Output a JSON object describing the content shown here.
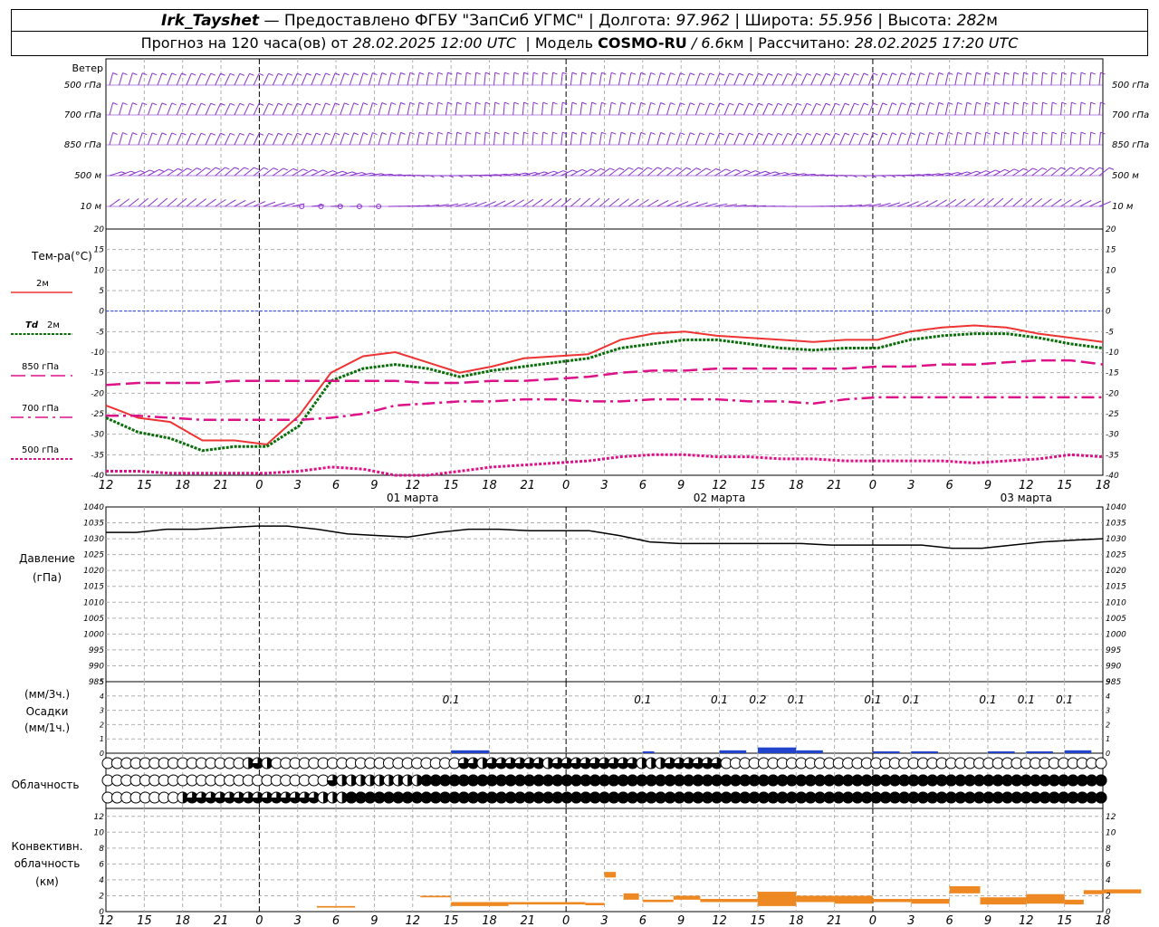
{
  "header": {
    "station": "Irk_Tayshet",
    "provider": "— Предоставлено ФГБУ \"ЗапСиб УГМС\"",
    "lon_label": "Долгота:",
    "lon_value": "97.962",
    "lat_label": "Широта:",
    "lat_value": "55.956",
    "alt_label": "Высота:",
    "alt_value": "282",
    "alt_unit": "м",
    "forecast_label": "Прогноз на 120 часа(ов) от",
    "forecast_time": "28.02.2025 12:00 UTC",
    "model_label": "Модель",
    "model_name": "COSMO-RU",
    "model_res": "/ 6.6",
    "model_res_unit": "км",
    "calc_label": "Рассчитано:",
    "calc_time": "28.02.2025 17:20 UTC"
  },
  "labels": {
    "wind": "Ветер",
    "wind_levels": [
      "500 гПа",
      "700 гПа",
      "850 гПа",
      "500 м",
      "10 м"
    ],
    "temp_title": "Тем-ра(°C)",
    "temp_2m": "2м",
    "td_2m_a": "Td",
    "td_2m_b": "2м",
    "temp_850": "850 гПа",
    "temp_700": "700 гПа",
    "temp_500": "500 гПа",
    "pressure_a": "Давление",
    "pressure_b": "(гПа)",
    "precip_a": "(мм/3ч.)",
    "precip_b": "Осадки",
    "precip_c": "(мм/1ч.)",
    "cloud": "Облачность",
    "conv_a": "Конвективн.",
    "conv_b": "облачность",
    "conv_c": "(км)"
  },
  "chart_data": {
    "type": "line",
    "x_ticks": [
      "12",
      "15",
      "18",
      "21",
      "0",
      "3",
      "6",
      "9",
      "12",
      "15",
      "18",
      "21",
      "0",
      "3",
      "6",
      "9",
      "12",
      "15",
      "18",
      "21",
      "0",
      "3",
      "6",
      "9",
      "12",
      "15",
      "18"
    ],
    "date_labels": [
      "01 марта",
      "02 марта",
      "03 марта"
    ],
    "date_label_ticks": [
      8,
      16,
      24
    ],
    "colors": {
      "t2m": "#ee3333",
      "td2m": "#0a6e0a",
      "t850": "#dd1188",
      "t700": "#dd1188",
      "t500": "#dd1188",
      "pressure": "#000000",
      "precip": "#2244cc",
      "conv": "#ee8822",
      "wind": "#8833cc",
      "zero": "#2244ee"
    },
    "temperature": {
      "ylim": [
        -40,
        20
      ],
      "yticks": [
        20,
        15,
        10,
        5,
        0,
        -5,
        -10,
        -15,
        -20,
        -25,
        -30,
        -35,
        -40
      ],
      "series": [
        {
          "key": "t2m",
          "name": "2м",
          "values": [
            -23,
            -26,
            -27,
            -31.5,
            -31.5,
            -32.5,
            -25.5,
            -15,
            -11,
            -10,
            -12.5,
            -15,
            -13.5,
            -11.5,
            -11,
            -10.5,
            -7,
            -5.5,
            -5,
            -6,
            -6.5,
            -7,
            -7.5,
            -7,
            -7,
            -5,
            -4,
            -3.5,
            -4,
            -5.5,
            -6.5,
            -7.5
          ]
        },
        {
          "key": "td2m",
          "name": "Td 2м",
          "values": [
            -26,
            -29.5,
            -31,
            -34,
            -33,
            -33,
            -28,
            -17,
            -14,
            -13,
            -14,
            -16,
            -14.5,
            -13.5,
            -12.5,
            -11.5,
            -9,
            -8,
            -7,
            -7,
            -8,
            -9,
            -9.5,
            -9,
            -9,
            -7,
            -6,
            -5.5,
            -5.5,
            -6.5,
            -8,
            -9
          ]
        },
        {
          "key": "t850",
          "name": "850 гПа",
          "values": [
            -18,
            -17.5,
            -17.5,
            -17.5,
            -17,
            -17,
            -17,
            -17,
            -17,
            -17,
            -17.5,
            -17.5,
            -17,
            -17,
            -16.5,
            -16,
            -15,
            -14.5,
            -14.5,
            -14,
            -14,
            -14,
            -14,
            -14,
            -13.5,
            -13.5,
            -13,
            -13,
            -12.5,
            -12,
            -12,
            -13
          ]
        },
        {
          "key": "t700",
          "name": "700 гПа",
          "values": [
            -25.5,
            -25.5,
            -26,
            -26.5,
            -26.5,
            -26.5,
            -26.5,
            -26,
            -25,
            -23,
            -22.5,
            -22,
            -22,
            -21.5,
            -21.5,
            -22,
            -22,
            -21.5,
            -21.5,
            -21.5,
            -22,
            -22,
            -22.5,
            -21.5,
            -21,
            -21,
            -21,
            -21,
            -21,
            -21,
            -21,
            -21
          ]
        },
        {
          "key": "t500",
          "name": "500 гПа",
          "values": [
            -39,
            -39,
            -39.5,
            -39.5,
            -39.5,
            -39.5,
            -39,
            -38,
            -38.5,
            -40,
            -40,
            -39,
            -38,
            -37.5,
            -37,
            -36.5,
            -35.5,
            -35,
            -35,
            -35.5,
            -35.5,
            -36,
            -36,
            -36.5,
            -36.5,
            -36.5,
            -36.5,
            -37,
            -36.5,
            -36,
            -35,
            -35.5
          ]
        }
      ]
    },
    "pressure": {
      "ylim": [
        985,
        1040
      ],
      "yticks": [
        1040,
        1035,
        1030,
        1025,
        1020,
        1015,
        1010,
        1005,
        1000,
        995,
        990,
        985
      ],
      "values": [
        1032,
        1032,
        1033,
        1033,
        1033.5,
        1034,
        1034,
        1033,
        1031.5,
        1031,
        1030.5,
        1032,
        1033,
        1033,
        1032.5,
        1032.5,
        1032.5,
        1031,
        1029,
        1028.5,
        1028.5,
        1028.5,
        1028.5,
        1028.5,
        1028,
        1028,
        1028,
        1028,
        1027,
        1027,
        1028,
        1029,
        1029.5,
        1030
      ]
    },
    "precipitation": {
      "ylim": [
        0,
        5
      ],
      "yticks": [
        5,
        4,
        3,
        2,
        1,
        0
      ],
      "labels": [
        "0.1",
        "0.1",
        "0.1",
        "0.2",
        "0.1",
        "0.1",
        "0.1",
        "0.1",
        "0.1",
        "0.1"
      ],
      "label_ticks": [
        9,
        14,
        16,
        17,
        18,
        20,
        21,
        23,
        24,
        25
      ],
      "bars": [
        {
          "start": 9.0,
          "end": 10.0,
          "value": 0.1
        },
        {
          "start": 14.0,
          "end": 14.3,
          "value": 0.05
        },
        {
          "start": 16.0,
          "end": 16.7,
          "value": 0.1
        },
        {
          "start": 17.0,
          "end": 18.0,
          "value": 0.2
        },
        {
          "start": 18.0,
          "end": 18.7,
          "value": 0.1
        },
        {
          "start": 20.0,
          "end": 20.7,
          "value": 0.05
        },
        {
          "start": 21.0,
          "end": 21.7,
          "value": 0.05
        },
        {
          "start": 23.0,
          "end": 23.7,
          "value": 0.05
        },
        {
          "start": 24.0,
          "end": 24.7,
          "value": 0.05
        },
        {
          "start": 25.0,
          "end": 25.7,
          "value": 0.1
        }
      ]
    },
    "cloud_cover": {
      "rows_note": "oktas 0-8 per step, three levels",
      "upper": [
        0,
        0,
        0,
        0,
        0,
        0,
        0,
        0,
        0,
        0,
        0,
        0,
        0,
        0,
        0,
        0,
        0,
        0,
        0,
        0,
        0,
        0,
        0,
        0,
        0,
        0,
        0,
        0,
        0,
        0,
        0,
        0,
        0,
        0,
        0,
        0,
        0,
        0,
        0,
        0,
        0,
        0,
        0,
        0,
        0,
        0,
        0,
        0,
        0,
        0,
        0,
        0,
        0,
        0,
        0,
        0,
        0,
        0,
        0,
        0,
        0,
        0,
        0,
        0,
        0,
        0,
        0,
        0,
        0,
        0,
        0,
        0,
        0,
        0,
        0,
        0,
        0,
        0,
        0,
        0,
        0,
        0,
        0,
        0,
        0,
        0,
        0,
        0,
        0,
        0,
        0,
        0,
        0,
        0,
        0,
        0,
        0,
        0,
        0,
        0,
        0
      ],
      "upper_sparse": {
        "15": 4,
        "16": 6,
        "17": 4,
        "38": 6,
        "39": 6,
        "40": 4,
        "41": 6,
        "42": 6,
        "43": 6,
        "44": 6,
        "45": 6,
        "46": 6,
        "47": 4,
        "48": 6,
        "49": 6,
        "50": 6,
        "51": 6,
        "52": 6,
        "53": 6,
        "54": 6,
        "55": 6,
        "56": 6,
        "57": 4,
        "58": 4,
        "59": 4,
        "60": 6,
        "61": 6,
        "62": 6,
        "63": 6,
        "64": 6,
        "65": 6
      },
      "middle_sparse": {
        "24": 6,
        "25": 4,
        "26": 4,
        "27": 4,
        "28": 4,
        "29": 4,
        "30": 4,
        "31": 4,
        "32": 4,
        "33": 4,
        "34": 8,
        "35": 8,
        "36": 8,
        "37": 8,
        "38": 8,
        "39": 8,
        "40": 8,
        "41": 8,
        "42": 8,
        "43": 8,
        "44": 8,
        "45": 8,
        "46": 8,
        "47": 8,
        "48": 8,
        "49": 8,
        "50": 8,
        "51": 8,
        "52": 8,
        "53": 8,
        "54": 8,
        "55": 8,
        "56": 8,
        "57": 8,
        "58": 8,
        "59": 8,
        "60": 8,
        "61": 8,
        "62": 8,
        "63": 8,
        "64": 8,
        "65": 8,
        "66": 8,
        "67": 8,
        "68": 8,
        "69": 8,
        "70": 8,
        "71": 8,
        "72": 8,
        "73": 8,
        "74": 8,
        "75": 8,
        "76": 8,
        "77": 8,
        "78": 8,
        "79": 8,
        "80": 8,
        "81": 8,
        "82": 8,
        "83": 8,
        "84": 8,
        "85": 8,
        "86": 8,
        "87": 8,
        "88": 8,
        "89": 8,
        "90": 8,
        "91": 8,
        "92": 8,
        "93": 8,
        "94": 8,
        "95": 8,
        "96": 8,
        "97": 8,
        "98": 8,
        "99": 8,
        "100": 8,
        "101": 8,
        "102": 8,
        "103": 8,
        "104": 8,
        "105": 8,
        "106": 8
      },
      "lower_sparse": {
        "8": 4,
        "9": 6,
        "10": 6,
        "11": 6,
        "12": 6,
        "13": 6,
        "14": 6,
        "15": 6,
        "16": 6,
        "17": 6,
        "18": 6,
        "19": 6,
        "20": 6,
        "21": 6,
        "22": 6,
        "23": 4,
        "24": 4,
        "25": 4,
        "26": 8,
        "27": 8,
        "28": 8,
        "29": 8,
        "30": 8,
        "31": 8,
        "32": 8,
        "33": 8,
        "34": 8,
        "35": 8,
        "36": 8,
        "37": 8,
        "38": 8,
        "39": 8,
        "40": 8,
        "41": 8,
        "42": 8,
        "43": 8,
        "44": 8,
        "45": 8,
        "46": 8,
        "47": 8,
        "48": 8,
        "49": 8,
        "50": 8,
        "51": 8,
        "52": 8,
        "53": 8,
        "54": 8,
        "55": 8,
        "56": 8,
        "57": 8,
        "58": 8,
        "59": 8,
        "60": 8,
        "61": 8,
        "62": 8,
        "63": 8,
        "64": 8,
        "65": 8,
        "66": 8,
        "67": 8,
        "68": 8,
        "69": 8,
        "70": 8,
        "71": 8,
        "72": 8,
        "73": 8,
        "74": 8,
        "75": 8,
        "76": 8,
        "77": 8,
        "78": 8,
        "79": 8,
        "80": 8,
        "81": 8,
        "82": 8,
        "83": 8,
        "84": 8,
        "85": 8,
        "86": 8,
        "87": 8,
        "88": 8,
        "89": 8,
        "90": 8,
        "91": 8,
        "92": 8,
        "93": 8,
        "94": 8,
        "95": 8,
        "96": 8,
        "97": 8,
        "98": 8,
        "99": 8,
        "100": 8,
        "101": 8,
        "102": 8,
        "103": 8,
        "104": 8,
        "105": 8,
        "106": 8
      }
    },
    "convective": {
      "ylim": [
        0,
        13
      ],
      "yticks": [
        12,
        10,
        8,
        6,
        4,
        2,
        0
      ],
      "bars": [
        {
          "start": 5.5,
          "end": 6.5,
          "low": 0.5,
          "high": 0.7
        },
        {
          "start": 8.2,
          "end": 9.0,
          "low": 1.8,
          "high": 2.0
        },
        {
          "start": 9.0,
          "end": 10.5,
          "low": 0.7,
          "high": 1.2
        },
        {
          "start": 10.5,
          "end": 12.5,
          "low": 0.9,
          "high": 1.2
        },
        {
          "start": 12.5,
          "end": 13.0,
          "low": 0.8,
          "high": 1.1
        },
        {
          "start": 13.0,
          "end": 13.3,
          "low": 4.3,
          "high": 5.0
        },
        {
          "start": 13.5,
          "end": 13.9,
          "low": 1.5,
          "high": 2.3
        },
        {
          "start": 14.0,
          "end": 14.8,
          "low": 1.2,
          "high": 1.5
        },
        {
          "start": 14.8,
          "end": 15.5,
          "low": 1.5,
          "high": 2.0
        },
        {
          "start": 15.5,
          "end": 17.0,
          "low": 1.2,
          "high": 1.6
        },
        {
          "start": 17.0,
          "end": 18.0,
          "low": 0.7,
          "high": 2.5
        },
        {
          "start": 18.0,
          "end": 19.0,
          "low": 1.2,
          "high": 2.0
        },
        {
          "start": 19.0,
          "end": 20.0,
          "low": 1.0,
          "high": 2.0
        },
        {
          "start": 20.0,
          "end": 21.0,
          "low": 1.2,
          "high": 1.6
        },
        {
          "start": 21.0,
          "end": 22.0,
          "low": 1.0,
          "high": 1.6
        },
        {
          "start": 22.0,
          "end": 22.8,
          "low": 2.3,
          "high": 3.2
        },
        {
          "start": 22.8,
          "end": 24.0,
          "low": 0.9,
          "high": 1.8
        },
        {
          "start": 24.0,
          "end": 25.0,
          "low": 1.0,
          "high": 2.2
        },
        {
          "start": 25.0,
          "end": 25.5,
          "low": 0.9,
          "high": 1.5
        },
        {
          "start": 25.5,
          "end": 26.0,
          "low": 2.2,
          "high": 2.7
        },
        {
          "start": 26.0,
          "end": 27.0,
          "low": 2.3,
          "high": 2.8
        }
      ]
    },
    "wind_rows": [
      "500 гПа",
      "700 гПа",
      "850 гПа",
      "500 м",
      "10 м"
    ]
  }
}
